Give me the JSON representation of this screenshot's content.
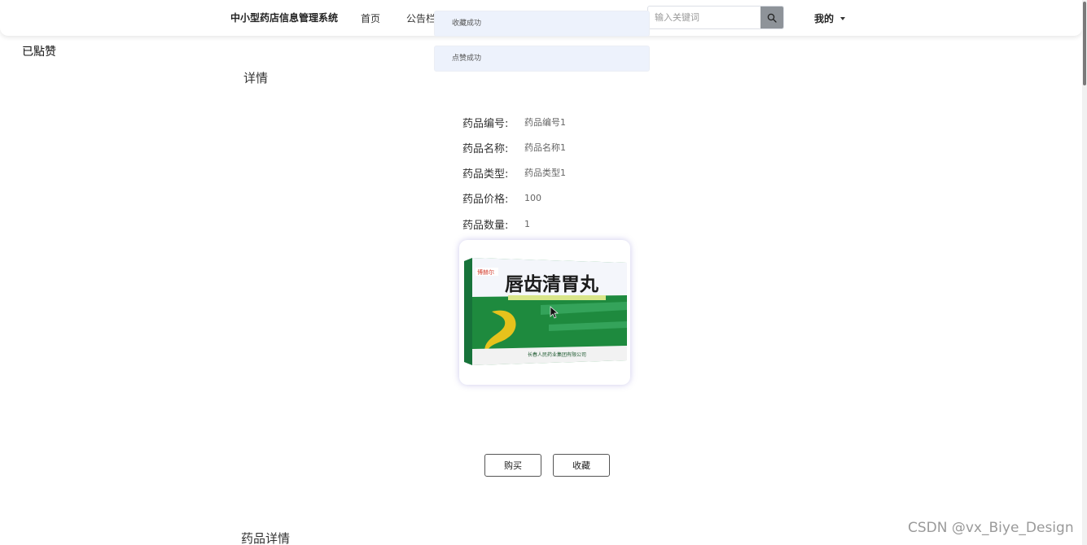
{
  "header": {
    "brand": "中小型药店信息管理系统",
    "nav": [
      {
        "label": "首页"
      },
      {
        "label": "公告栏"
      }
    ],
    "search": {
      "placeholder": "输入关键词",
      "value": "",
      "icon": "search-icon"
    },
    "user_menu": {
      "label": "我的",
      "icon": "caret-down-icon"
    }
  },
  "toasts": [
    {
      "text": "收藏成功"
    },
    {
      "text": "点赞成功"
    }
  ],
  "left_label": "已點赞",
  "detail": {
    "title": "详情",
    "fields": [
      {
        "label": "药品编号:",
        "value": "药品编号1"
      },
      {
        "label": "药品名称:",
        "value": "药品名称1"
      },
      {
        "label": "药品类型:",
        "value": "药品类型1"
      },
      {
        "label": "药品价格:",
        "value": "100"
      },
      {
        "label": "药品数量:",
        "value": "1"
      }
    ],
    "image": {
      "product_name": "唇齿清胃丸",
      "brand_mark": "博赫尔",
      "manufacturer": "长春人民药业集团有限公司"
    },
    "buttons": {
      "buy": "购买",
      "favorite": "收藏"
    }
  },
  "product_detail_title": "药品详情",
  "watermark": "CSDN @vx_Biye_Design",
  "colors": {
    "toast_bg": "#edf2fc",
    "search_button": "#8e9399",
    "box_green": "#1e8a3e",
    "box_yellow": "#e6c21c"
  }
}
